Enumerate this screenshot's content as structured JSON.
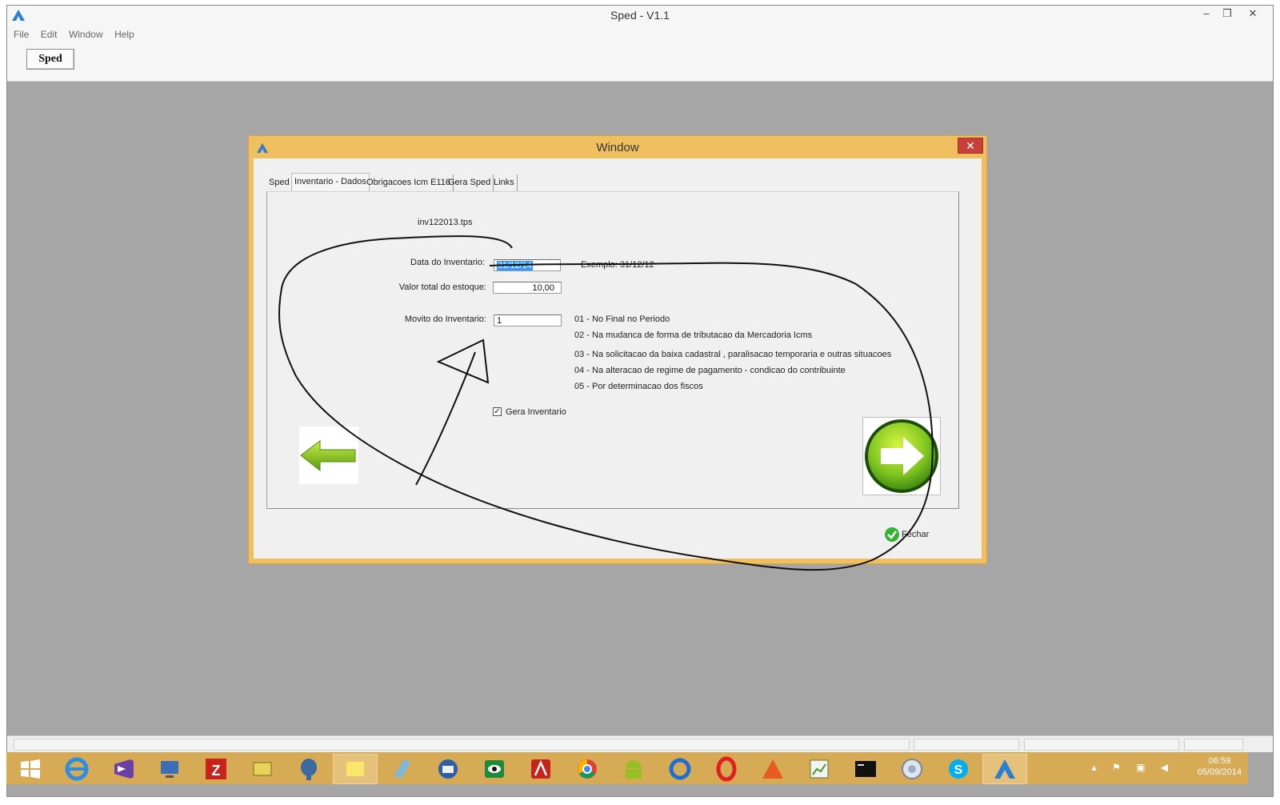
{
  "app": {
    "title": "Sped - V1.1",
    "menu": [
      "File",
      "Edit",
      "Window",
      "Help"
    ],
    "toolbar_button": "Sped",
    "window_controls": [
      "–",
      "❐",
      "✕"
    ]
  },
  "dialog": {
    "title": "Window",
    "close_label": "✕",
    "tabs": [
      "Sped",
      "Inventario - Dados",
      "Obrigacoes Icm E116",
      "Gera Sped",
      "Links"
    ],
    "active_tab": "Inventario - Dados",
    "filename": "inv122013.tps",
    "data_inventario_label": "Data do Inventario:",
    "data_inventario_value": "31/12/14",
    "exemplo": "Exemplo: 31/12/12",
    "valor_total_label": "Valor total do estoque:",
    "valor_total_value": "10,00",
    "movito_label": "Movito do Inventario:",
    "movito_value": "1",
    "motivos": [
      "01 - No Final no Periodo",
      "02 - Na mudanca de forma de tributacao da Mercadoria Icms",
      "03 - Na solicitacao da baixa cadastral , paralisacao temporaria e outras situacoes",
      "04 - Na alteracao de regime de pagamento - condicao do contribuinte",
      "05 - Por determinacao dos fiscos"
    ],
    "gera_inventario_label": "Gera Inventario",
    "gera_inventario_checked": true,
    "checkmark": "✓",
    "back_icon": "left-arrow-icon",
    "next_icon": "right-arrow-icon",
    "fechar_label": "Fechar"
  },
  "taskbar": {
    "icons": [
      "windows-start-icon",
      "internet-explorer-icon",
      "visual-studio-icon",
      "remote-desktop-icon",
      "filezilla-icon",
      "tool-icon",
      "postgresql-icon",
      "sticky-notes-icon",
      "notepad-icon",
      "thunderbird-icon",
      "media-icon",
      "acrobat-icon",
      "chrome-icon",
      "android-icon",
      "ccleaner-icon",
      "opera-icon",
      "app-icon",
      "spreadsheet-icon",
      "terminal-icon",
      "globe-icon",
      "skype-icon",
      "sped-app-icon"
    ],
    "time": "06:59",
    "date": "05/09/2014"
  },
  "colors": {
    "dialog_frame": "#f0c060",
    "desktop_bg": "#a6a6a6",
    "taskbar": "#d7aa55",
    "selection": "#3399ff",
    "close_red": "#c7403a"
  }
}
